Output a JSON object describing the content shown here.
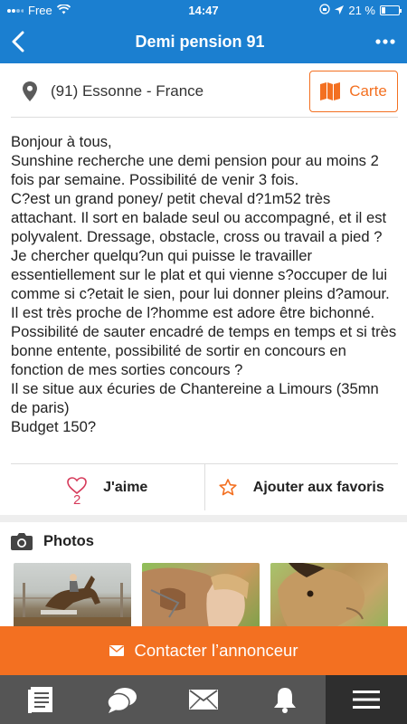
{
  "status": {
    "carrier": "Free",
    "time": "14:47",
    "battery": "21 %",
    "battery_level": 0.21
  },
  "header": {
    "title": "Demi pension 91"
  },
  "location": {
    "text": "(91) Essonne - France",
    "map_button": "Carte"
  },
  "description": "Bonjour à tous,\nSunshine recherche une demi pension pour au moins 2 fois par semaine. Possibilité de venir 3 fois.\nC?est un grand poney/ petit cheval d?1m52 très attachant. Il sort en balade seul ou accompagné, et il est polyvalent. Dressage, obstacle, cross ou travail a pied ?\nJe chercher quelqu?un qui puisse le travailler essentiellement sur le plat et qui vienne s?occuper de lui comme si c?etait le sien, pour lui donner pleins d?amour. Il est très proche de l?homme est adore être bichonné. Possibilité de sauter encadré de temps en temps et si très bonne entente, possibilité de sortir en concours en fonction de mes sorties concours ?\nIl se situe aux écuries de Chantereine a Limours (35mn de paris)\nBudget 150?",
  "actions": {
    "like_count": "2",
    "like_label": "J'aime",
    "favorite_label": "Ajouter aux favoris"
  },
  "photos": {
    "header": "Photos"
  },
  "contact": {
    "label": "Contacter l’annonceur"
  },
  "colors": {
    "primary": "#1b7fd0",
    "accent": "#f37021",
    "like": "#d63a5a",
    "tabbar": "#555555"
  },
  "icons": {
    "tabs": [
      "document-icon",
      "chat-icon",
      "mail-icon",
      "bell-icon",
      "menu-icon"
    ]
  }
}
